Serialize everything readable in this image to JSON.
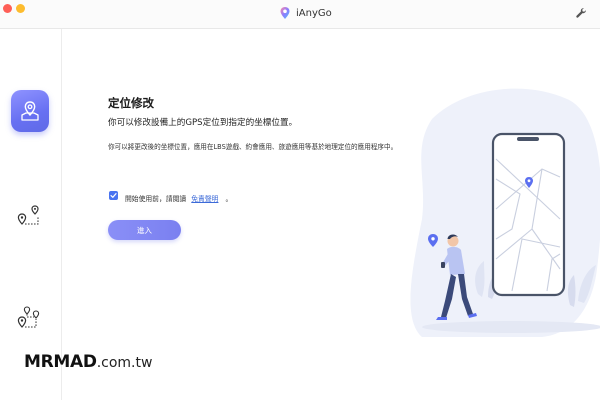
{
  "window": {
    "title": "iAnyGo",
    "icons": {
      "logo": "location-pin-logo-icon",
      "settings": "wrench-icon"
    }
  },
  "sidebar": {
    "items": [
      {
        "name": "change-location",
        "icon": "location-pin-map-icon",
        "active": true
      },
      {
        "name": "single-spot-movement",
        "icon": "route-two-pins-icon",
        "active": false
      },
      {
        "name": "multi-spot-movement",
        "icon": "route-multi-pins-icon",
        "active": false
      }
    ]
  },
  "main": {
    "title": "定位修改",
    "subtitle": "你可以修改設備上的GPS定位到指定的坐標位置。",
    "description": "你可以將更改後的坐標位置，應用在LBS遊戲、約會應用、旅遊應用等基於地理定位的應用程序中。",
    "agreement": {
      "checked": true,
      "text": "開始使用前，請閱讀",
      "link": "免責聲明",
      "suffix": "。"
    },
    "enter_button": "進入"
  },
  "watermark": {
    "bold": "MRMAD",
    "light": ".com.tw"
  },
  "colors": {
    "accent": "#6b73f2",
    "checkbox": "#4a74f0",
    "link": "#3c6ad8",
    "illustration_bg": "#eef1fa"
  }
}
